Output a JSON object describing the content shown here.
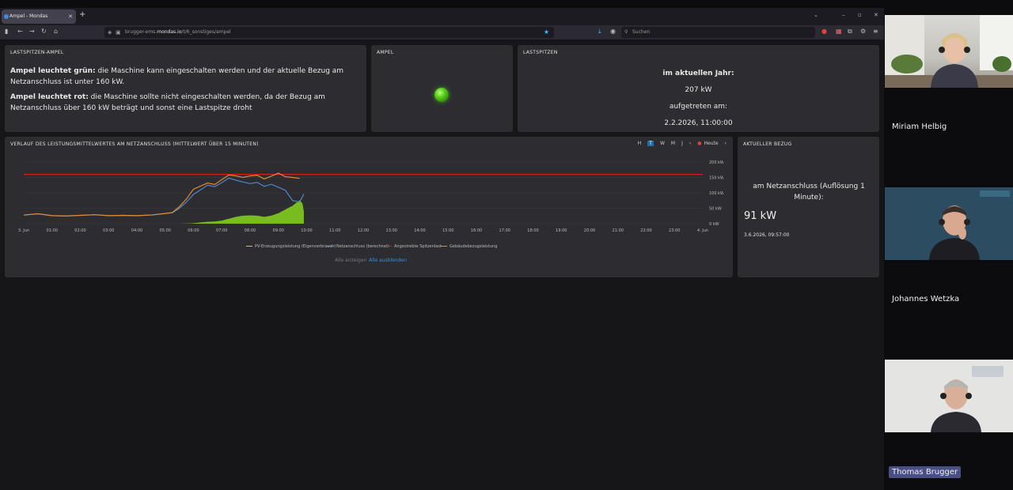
{
  "browser": {
    "tab_title": "Ampel - Mondas",
    "url_prefix": "brugger-ems.",
    "url_domain": "mondas.io",
    "url_path": "/t/6_sonstiges/ampel",
    "search_placeholder": "Suchen"
  },
  "lastspitzen_ampel": {
    "title": "LASTSPITZEN-AMPEL",
    "green_label": "Ampel leuchtet grün:",
    "green_text": " die Maschine kann eingeschalten werden und der aktuelle Bezug am Netzanschluss ist unter 160 kW.",
    "red_label": "Ampel leuchtet rot:",
    "red_text": " die Maschine sollte nicht eingeschalten werden, da der Bezug am Netzanschluss über 160 kW beträgt und sonst eine Lastspitze droht"
  },
  "ampel": {
    "title": "AMPEL",
    "state": "green",
    "color": "#5fd01c"
  },
  "lastspitzen": {
    "title": "LASTSPITZEN",
    "year_label": "im aktuellen Jahr:",
    "value": "207 kW",
    "occurred_label": "aufgetreten am:",
    "timestamp": "2.2.2026, 11:00:00"
  },
  "verlauf": {
    "title": "VERLAUF DES LEISTUNGSMITTELWERTES AM NETZANSCHLUSS (MITTELWERT ÜBER 15 MINUTEN)",
    "range_buttons": [
      "H",
      "T",
      "W",
      "M",
      "J"
    ],
    "range_active": "T",
    "nav_prev": "‹",
    "today_label": "Heute",
    "nav_next": "›",
    "show_all": "Alle anzeigen",
    "hide_all": "Alle ausblenden"
  },
  "chart_data": {
    "type": "line",
    "x_ticks": [
      "3. Jun",
      "01:00",
      "02:00",
      "03:00",
      "04:00",
      "05:00",
      "06:00",
      "07:00",
      "08:00",
      "09:00",
      "10:00",
      "11:00",
      "12:00",
      "13:00",
      "14:00",
      "15:00",
      "16:00",
      "17:00",
      "18:00",
      "19:00",
      "20:00",
      "21:00",
      "22:00",
      "23:00",
      "4. Jun"
    ],
    "y_ticks": [
      "0 kW",
      "50 kW",
      "100 kW",
      "150 kW",
      "200 kW"
    ],
    "ylim": [
      0,
      200
    ],
    "xlim": [
      0,
      24
    ],
    "series": [
      {
        "name": "PV-Erzeugungsleistung (Eigenverbrauch)",
        "type": "area",
        "color": "#7cc41f",
        "x": [
          0,
          5,
          5.5,
          5.9,
          6.25,
          6.5,
          6.75,
          7,
          7.25,
          7.5,
          7.75,
          8,
          8.25,
          8.5,
          8.75,
          9,
          9.25,
          9.5,
          9.75,
          9.85,
          9.9
        ],
        "values": [
          0,
          0,
          0,
          1,
          4,
          6,
          7,
          10,
          16,
          22,
          26,
          27,
          26,
          22,
          26,
          34,
          46,
          58,
          76,
          66,
          40
        ]
      },
      {
        "name": "Netzanschluss (berechnet)",
        "type": "line",
        "color": "#4f86c9",
        "x": [
          0,
          0.5,
          1,
          1.5,
          2,
          2.5,
          3,
          3.5,
          4,
          4.5,
          5,
          5.25,
          5.5,
          5.75,
          6,
          6.25,
          6.5,
          6.75,
          7,
          7.25,
          7.5,
          7.75,
          8,
          8.25,
          8.5,
          8.75,
          9,
          9.25,
          9.5,
          9.75,
          9.9
        ],
        "values": [
          28,
          32,
          26,
          25,
          27,
          29,
          26,
          27,
          26,
          28,
          33,
          35,
          50,
          70,
          95,
          110,
          125,
          120,
          133,
          148,
          141,
          135,
          130,
          134,
          121,
          128,
          118,
          108,
          75,
          70,
          96
        ]
      },
      {
        "name": "Angestrebte Spitzenlast",
        "type": "line",
        "color": "#d02020",
        "x": [
          0,
          24
        ],
        "values": [
          160,
          160
        ]
      },
      {
        "name": "Gebäudebezugsleistung",
        "type": "line",
        "color": "#e08a30",
        "x": [
          0,
          0.5,
          1,
          1.5,
          2,
          2.5,
          3,
          3.5,
          4,
          4.5,
          5,
          5.25,
          5.5,
          5.75,
          6,
          6.25,
          6.5,
          6.75,
          7,
          7.25,
          7.5,
          7.75,
          8,
          8.25,
          8.5,
          8.75,
          9,
          9.25,
          9.5,
          9.75
        ],
        "values": [
          28,
          32,
          26,
          25,
          27,
          29,
          26,
          27,
          26,
          28,
          33,
          36,
          55,
          80,
          112,
          122,
          132,
          127,
          143,
          158,
          155,
          150,
          155,
          157,
          145,
          154,
          164,
          152,
          150,
          147
        ]
      }
    ]
  },
  "aktueller_bezug": {
    "title": "AKTUELLER BEZUG",
    "label": "am Netzanschluss (Auflösung 1 Minute):",
    "value": "91 kW",
    "timestamp": "3.6.2026, 09:57:00"
  },
  "participants": [
    {
      "name": "Miriam Helbig"
    },
    {
      "name": "Johannes Wetzka"
    },
    {
      "name": "Thomas Brugger"
    }
  ]
}
